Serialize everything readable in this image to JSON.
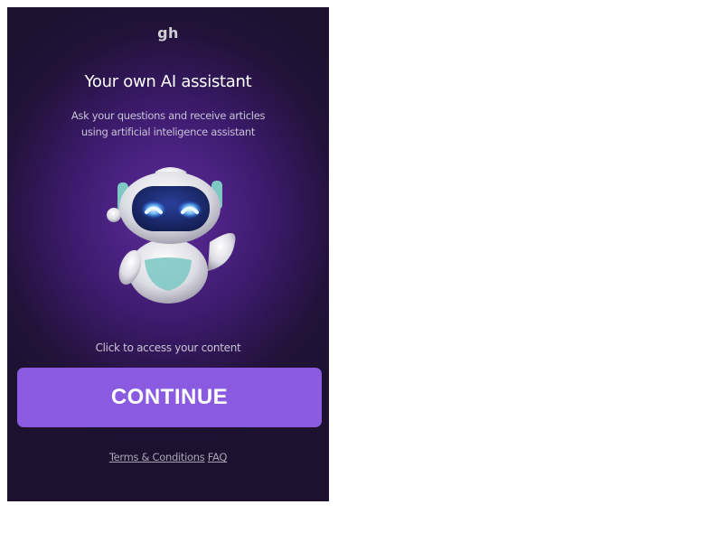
{
  "app": {
    "logo_text": "gh"
  },
  "hero": {
    "title": "Your own AI assistant",
    "subtitle_line1": "Ask your questions and receive articles",
    "subtitle_line2": "using artificial inteligence assistant",
    "illustration": "robot-mascot-icon"
  },
  "cta": {
    "hint": "Click to access your content",
    "button_label": "CONTINUE"
  },
  "footer": {
    "terms_label": "Terms & Conditions",
    "faq_label": "FAQ"
  },
  "colors": {
    "background_dark": "#1c1230",
    "background_glow": "#5e2b9c",
    "button": "#8a5be0",
    "text_primary": "#ffffff",
    "text_secondary": "#c9c3d6",
    "robot_eyes": "#4aa8ff",
    "robot_accent": "#7fc9c4"
  }
}
